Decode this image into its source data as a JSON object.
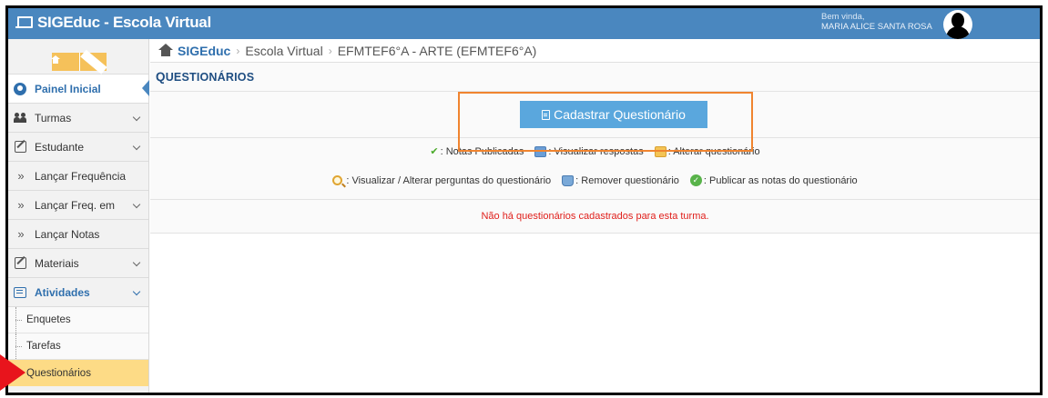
{
  "header": {
    "brand": "SIGEduc - Escola Virtual",
    "welcome": "Bem vinda,",
    "user_name": "MARIA ALICE SANTA ROSA"
  },
  "sidebar": {
    "items": [
      {
        "label": "Painel Inicial",
        "icon": "dashboard-icon",
        "active": true
      },
      {
        "label": "Turmas",
        "icon": "users-icon",
        "expandable": true
      },
      {
        "label": "Estudante",
        "icon": "edit-icon",
        "expandable": true
      },
      {
        "label": "Lançar Frequência",
        "icon": "double-chevron-icon"
      },
      {
        "label": "Lançar Freq. em",
        "icon": "double-chevron-icon",
        "expandable": true
      },
      {
        "label": "Lançar Notas",
        "icon": "double-chevron-icon"
      },
      {
        "label": "Materiais",
        "icon": "edit-icon",
        "expandable": true
      },
      {
        "label": "Atividades",
        "icon": "list-icon",
        "expandable": true,
        "open": true
      }
    ],
    "subitems": [
      {
        "label": "Enquetes"
      },
      {
        "label": "Tarefas"
      },
      {
        "label": "Questionários",
        "selected": true
      }
    ]
  },
  "breadcrumb": {
    "root": "SIGEduc",
    "level1": "Escola Virtual",
    "level2": "EFMTEF6°A - ARTE (EFMTEF6°A)"
  },
  "page": {
    "title_first": "Q",
    "title_rest": "UESTIONÁRIOS",
    "primary_button": "Cadastrar Questionário"
  },
  "legend": {
    "line1": [
      {
        "icon": "check-icon",
        "text": ": Notas Publicadas"
      },
      {
        "icon": "view-answers-icon",
        "text": ": Visualizar respostas"
      },
      {
        "icon": "edit-questionnaire-icon",
        "text": ": Alterar questionário"
      }
    ],
    "line2": [
      {
        "icon": "magnifier-icon",
        "text": ": Visualizar / Alterar perguntas do questionário"
      },
      {
        "icon": "trash-icon",
        "text": ": Remover questionário"
      },
      {
        "icon": "publish-icon",
        "text": ": Publicar as notas do questionário"
      }
    ]
  },
  "empty_message": "Não há questionários cadastrados para esta turma.",
  "colors": {
    "topbar": "#4a87bf",
    "button": "#5aa7dd",
    "highlight": "#f0842f",
    "selected": "#fddb86",
    "error": "#e0201c"
  }
}
